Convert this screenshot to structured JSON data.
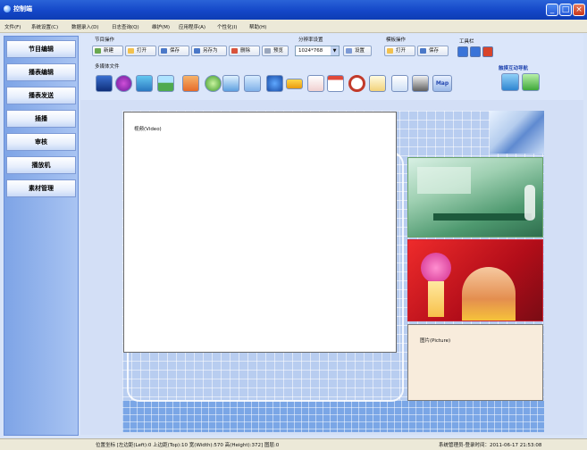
{
  "window": {
    "title": "控制端",
    "controls": [
      "_",
      "□",
      "×"
    ]
  },
  "menu": [
    "文件(F)",
    "系统设置(C)",
    "数据录入(D)",
    "日志查询(Q)",
    "维护(M)",
    "应用程序(A)",
    "个性化(I)",
    "帮助(H)"
  ],
  "sidebar": {
    "items": [
      "节目编辑",
      "播表编辑",
      "播表发送",
      "插播",
      "审核",
      "播放机",
      "素材管理"
    ]
  },
  "toolbar": {
    "program_ops_label": "节目操作",
    "new_label": "新建",
    "open_label": "打开",
    "save_label": "保存",
    "save_as_label": "另存为",
    "delete_label": "删除",
    "preview_label": "预览",
    "resolution_label": "分辨率设置",
    "resolution_value": "1024*768",
    "settings_label": "设置",
    "template_ops_label": "模板操作",
    "template_open_label": "打开",
    "template_save_label": "保存",
    "toolbox_label": "工具栏",
    "touch_nav_label": "触摸互动导航",
    "multimedia_label": "多媒体文件"
  },
  "multimedia_icons": [
    "video-file-icon",
    "flash-icon",
    "image-icon",
    "landscape-icon",
    "web-icon",
    "weather-icon",
    "scroll-text-icon",
    "document-icon",
    "ie-browser-icon",
    "text-banner-icon",
    "ppt-icon",
    "calendar-icon",
    "clock-icon",
    "notification-icon",
    "stock-icon",
    "excel-icon",
    "map-icon"
  ],
  "stage": {
    "video_label": "视频(Video)",
    "picture_label": "图片(Picture)"
  },
  "status": {
    "position_text": "位置坐标 [左边距(Left):0 上边距(Top):10 宽(Width):570 高(Height):372] 图层:0",
    "user_time_text": "系统管理员-登录时间：2011-06-17 21:53:08"
  },
  "colors": {
    "title_bar": "#1447c8",
    "sidebar_bg": "#7ea4e6",
    "canvas_bg": "#d3dff6",
    "stage_grid": "#b8cdf0"
  }
}
